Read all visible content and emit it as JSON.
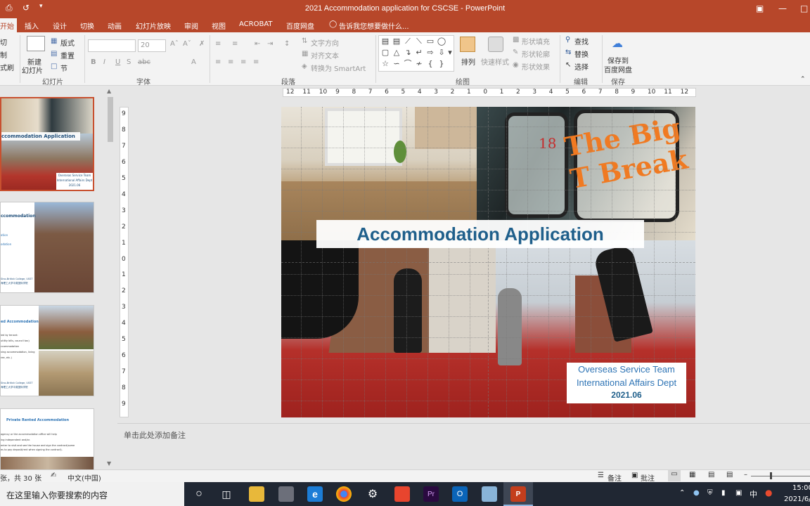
{
  "window": {
    "title": "2021 Accommodation application for CSCSE - PowerPoint",
    "accent": "#b7472a"
  },
  "tabs": [
    "开始",
    "插入",
    "设计",
    "切换",
    "动画",
    "幻灯片放映",
    "审阅",
    "视图",
    "ACROBAT",
    "百度网盘"
  ],
  "tell_me": "告诉我您想要做什么...",
  "ribbon": {
    "clipboard": {
      "cut": "切",
      "copy": "制",
      "format": "式刷"
    },
    "slides": {
      "new_slide_line1": "新建",
      "new_slide_line2": "幻灯片",
      "layout": "版式",
      "reset": "重置",
      "section": "节",
      "group": "幻灯片"
    },
    "font": {
      "size": "20",
      "group": "字体",
      "bold": "B",
      "italic": "I",
      "underline": "U",
      "shadow": "S",
      "strike": "abc",
      "font_color": "A"
    },
    "paragraph": {
      "text_direction": "文字方向",
      "align_text": "对齐文本",
      "smartart": "转换为 SmartArt",
      "group": "段落"
    },
    "drawing": {
      "arrange": "排列",
      "quick_styles": "快速样式",
      "shape_fill": "形状填充",
      "shape_outline": "形状轮廓",
      "shape_effects": "形状效果",
      "group": "绘图"
    },
    "editing": {
      "find": "查找",
      "replace": "替换",
      "select": "选择",
      "group": "编辑"
    },
    "save": {
      "line1": "保存到",
      "line2": "百度网盘",
      "group": "保存"
    }
  },
  "ruler": {
    "h_ticks": [
      "12",
      "11",
      "10",
      "9",
      "8",
      "7",
      "6",
      "5",
      "4",
      "3",
      "2",
      "1",
      "0",
      "1",
      "2",
      "3",
      "4",
      "5",
      "6",
      "7",
      "8",
      "9",
      "10",
      "11",
      "12"
    ],
    "v_ticks": [
      "9",
      "8",
      "7",
      "6",
      "5",
      "4",
      "3",
      "2",
      "1",
      "0",
      "1",
      "2",
      "3",
      "4",
      "5",
      "6",
      "7",
      "8",
      "9"
    ]
  },
  "slide": {
    "title": "Accommodation Application",
    "team": "Overseas Service Team",
    "dept": "International Affairs Dept",
    "date": "2021.06",
    "graffiti": "The Big T Break",
    "graffiti_num": "18"
  },
  "thumbnails": {
    "t1_title": "ccommodation Application",
    "t1_box_line1": "Overseas Service Team",
    "t1_box_line2": "International Affairs Dept",
    "t1_box_line3": "2021.06",
    "t2_title": "ccommodation",
    "t2_item1": "ation",
    "t2_item2": "odation",
    "t2_footer1": "Sino-British College, USST",
    "t2_footer2": "海理工大学中英国际学院",
    "t3_title": "ed Accommodation",
    "t3_lines": [
      "ied by tenant:",
      "utility bills, council tax)",
      "ccommodation",
      "ving accommodation, living",
      "ree, etc.)"
    ],
    "t3_footer1": "Sino-British College, USST",
    "t3_footer2": "海理工大学中英国际学院",
    "t4_title": "Private Rented Accommodation",
    "t4_lines": [
      "agency or the accommodation office will help",
      "ing independent and/or.",
      "enter to visit and see the house and sign the contract(some",
      "es to pay deposit/rent when signing the contract)."
    ]
  },
  "notes_placeholder": "单击此处添加备注",
  "status": {
    "slide_count": "张，共 30 张",
    "language": "中文(中国)",
    "notes": "备注",
    "comments": "批注"
  },
  "taskbar": {
    "search_placeholder": "在这里输入你要搜索的内容",
    "time": "15:00",
    "date": "2021/6/",
    "ime": "中"
  }
}
